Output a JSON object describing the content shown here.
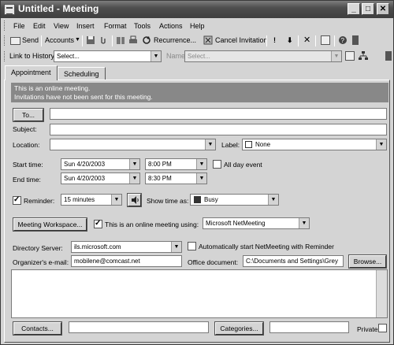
{
  "window": {
    "title": "Untitled - Meeting"
  },
  "menu": [
    "File",
    "Edit",
    "View",
    "Insert",
    "Format",
    "Tools",
    "Actions",
    "Help"
  ],
  "toolbar": {
    "send": "Send",
    "accounts": "Accounts",
    "recurrence": "Recurrence...",
    "cancel_invitation": "Cancel Invitation"
  },
  "history_bar": {
    "label": "Link to History",
    "select_value": "Select...",
    "name_label": "Name",
    "name_value": "Select..."
  },
  "tabs": [
    "Appointment",
    "Scheduling"
  ],
  "info_bar": {
    "line1": "This is an online meeting.",
    "line2": "Invitations have not been sent for this meeting."
  },
  "form": {
    "to_button": "To...",
    "to_value": "",
    "subject_label": "Subject:",
    "subject_value": "",
    "location_label": "Location:",
    "location_value": "",
    "label_label": "Label:",
    "label_value": "None",
    "start_label": "Start time:",
    "start_date": "Sun 4/20/2003",
    "start_time": "8:00 PM",
    "all_day_label": "All day event",
    "end_label": "End time:",
    "end_date": "Sun 4/20/2003",
    "end_time": "8:30 PM",
    "reminder_label": "Reminder:",
    "reminder_value": "15 minutes",
    "show_time_label": "Show time as:",
    "show_time_value": "Busy",
    "meeting_workspace_button": "Meeting Workspace...",
    "online_meeting_label": "This is an online meeting using:",
    "online_meeting_value": "Microsoft NetMeeting",
    "directory_label": "Directory Server:",
    "directory_value": "ils.microsoft.com",
    "auto_start_label": "Automatically start NetMeeting with Reminder",
    "organizer_label": "Organizer's e-mail:",
    "organizer_value": "mobilene@comcast.net",
    "office_doc_label": "Office document:",
    "office_doc_value": "C:\\Documents and Settings\\Grey",
    "browse_button": "Browse...",
    "contacts_button": "Contacts...",
    "categories_button": "Categories...",
    "private_label": "Private"
  },
  "colors": {
    "titlebar": "#4e4e4e",
    "info_bar": "#888888",
    "busy_swatch": "#333333"
  }
}
